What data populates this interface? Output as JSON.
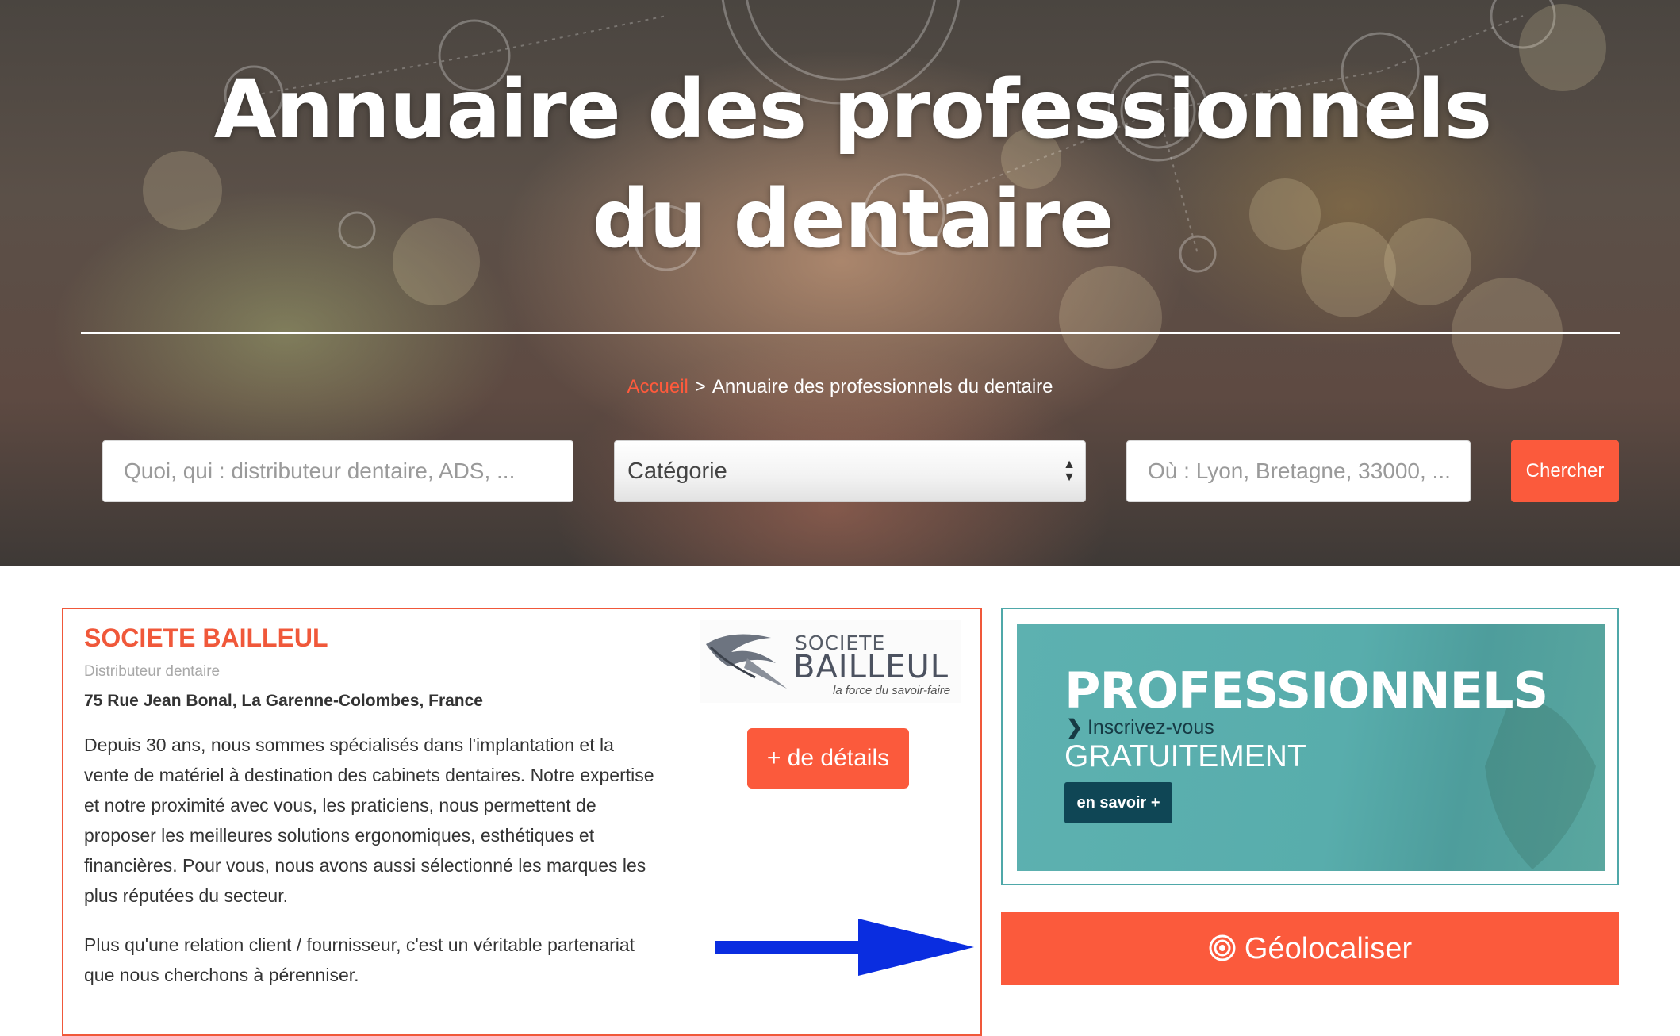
{
  "hero": {
    "title": "Annuaire des professionnels du dentaire"
  },
  "breadcrumb": {
    "home": "Accueil",
    "separator": ">",
    "current": "Annuaire des professionnels du dentaire"
  },
  "search": {
    "what_placeholder": "Quoi, qui : distributeur dentaire, ADS, ...",
    "category_selected": "Catégorie",
    "where_placeholder": "Où : Lyon, Bretagne, 33000, ...",
    "submit_label": "Chercher"
  },
  "listing": {
    "name": "SOCIETE BAILLEUL",
    "category": "Distributeur dentaire",
    "address": "75 Rue Jean Bonal, La Garenne-Colombes, France",
    "description": "Depuis 30 ans, nous sommes spécialisés dans l'implantation et la vente de matériel à destination des cabinets dentaires. Notre expertise et notre proximité avec vous, les praticiens, nous permettent de proposer les meilleures solutions ergonomiques, esthétiques et financières. Pour vous, nous avons aussi sélectionné les marques les plus réputées du secteur.",
    "description2": "Plus qu'une relation client / fournisseur, c'est un véritable partenariat que nous cherchons à pérenniser.",
    "logo": {
      "top": "SOCIETE",
      "main": "BAILLEUL",
      "tagline": "la force du savoir-faire"
    },
    "details_label": "+ de détails"
  },
  "sidebar": {
    "pro_banner": {
      "title": "PROFESSIONNELS",
      "subtitle": "Inscrivez-vous",
      "highlight": "GRATUITEMENT",
      "cta": "en savoir +"
    },
    "geo_label": "Géolocaliser"
  },
  "colors": {
    "accent": "#fb5a3c",
    "teal": "#58adac",
    "arrow": "#0a2de0"
  },
  "icons": {
    "arrow": "arrow-right-icon",
    "geo": "target-icon",
    "chevron": "chevron-right-icon",
    "select": "select-arrows-icon"
  }
}
